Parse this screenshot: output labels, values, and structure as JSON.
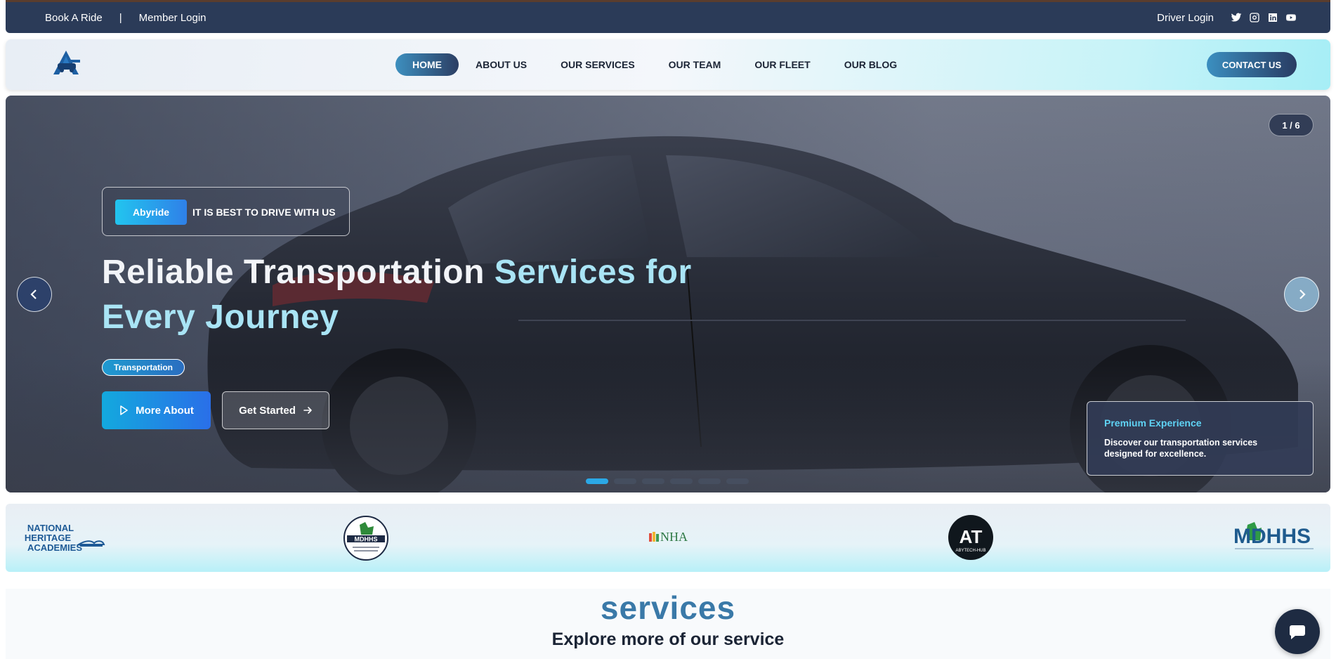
{
  "topbar": {
    "book_ride": "Book A Ride",
    "separator": "|",
    "member_login": "Member Login",
    "driver_login": "Driver Login",
    "social_icons": [
      "twitter-icon",
      "instagram-icon",
      "linkedin-icon",
      "youtube-icon"
    ]
  },
  "nav": {
    "logo_icon": "abyride-logo",
    "links": [
      "HOME",
      "ABOUT US",
      "OUR SERVICES",
      "OUR TEAM",
      "OUR FLEET",
      "OUR BLOG"
    ],
    "active": "HOME",
    "contact": "CONTACT US"
  },
  "hero": {
    "brand_badge": "Abyride",
    "tagline": "IT IS BEST TO DRIVE WITH US",
    "headline_part1": "Reliable",
    "headline_part2": "Transportation",
    "headline_part3": "Services for",
    "headline_line2": "Every Journey",
    "tag": "Transportation",
    "btn_more": "More About",
    "btn_start": "Get Started",
    "slide_counter": "1 / 6",
    "slide_total": 6,
    "slide_active": 1,
    "premium_title": "Premium Experience",
    "premium_desc": "Discover our transportation services designed for excellence."
  },
  "partners": {
    "logo1": "NATIONAL HERITAGE ACADEMIES",
    "logo1_line1": "NATIONAL",
    "logo1_line2": "HERITAGE",
    "logo1_line3": "ACADEMIES",
    "logo2": "MDHHS",
    "logo3": "NHA",
    "logo4": "ABYTECH-HUB",
    "logo4_mark": "AT",
    "logo5": "MDHHS"
  },
  "services": {
    "heading": "services",
    "subheading": "Explore more of our service"
  },
  "colors": {
    "topbar": "#2b3b58",
    "accent_cyan": "#22c5ef",
    "accent_blue": "#2f80e8",
    "heading_blue": "#3a79a8"
  }
}
